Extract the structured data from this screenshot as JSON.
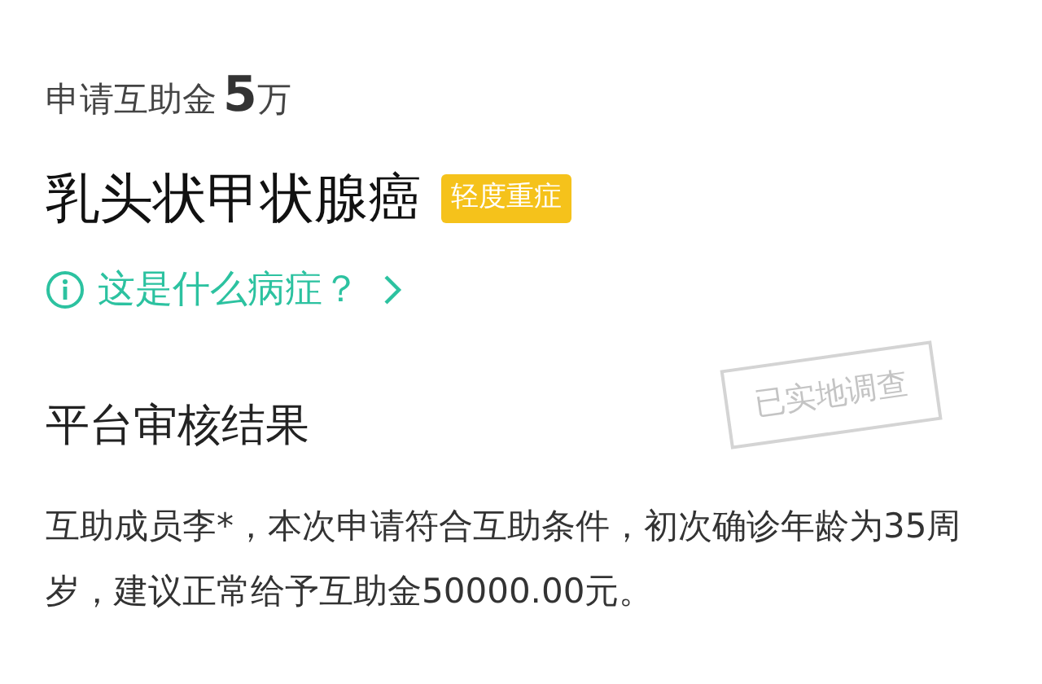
{
  "claim": {
    "label": "申请互助金",
    "amount": "5",
    "unit": "万"
  },
  "disease": {
    "name": "乳头状甲状腺癌",
    "badge": "轻度重症"
  },
  "info_link": {
    "text": "这是什么病症？"
  },
  "stamp": {
    "text": "已实地调查"
  },
  "review": {
    "title": "平台审核结果",
    "body": "互助成员李*，本次申请符合互助条件，初次确诊年龄为35周岁，建议正常给予互助金50000.00元。"
  }
}
